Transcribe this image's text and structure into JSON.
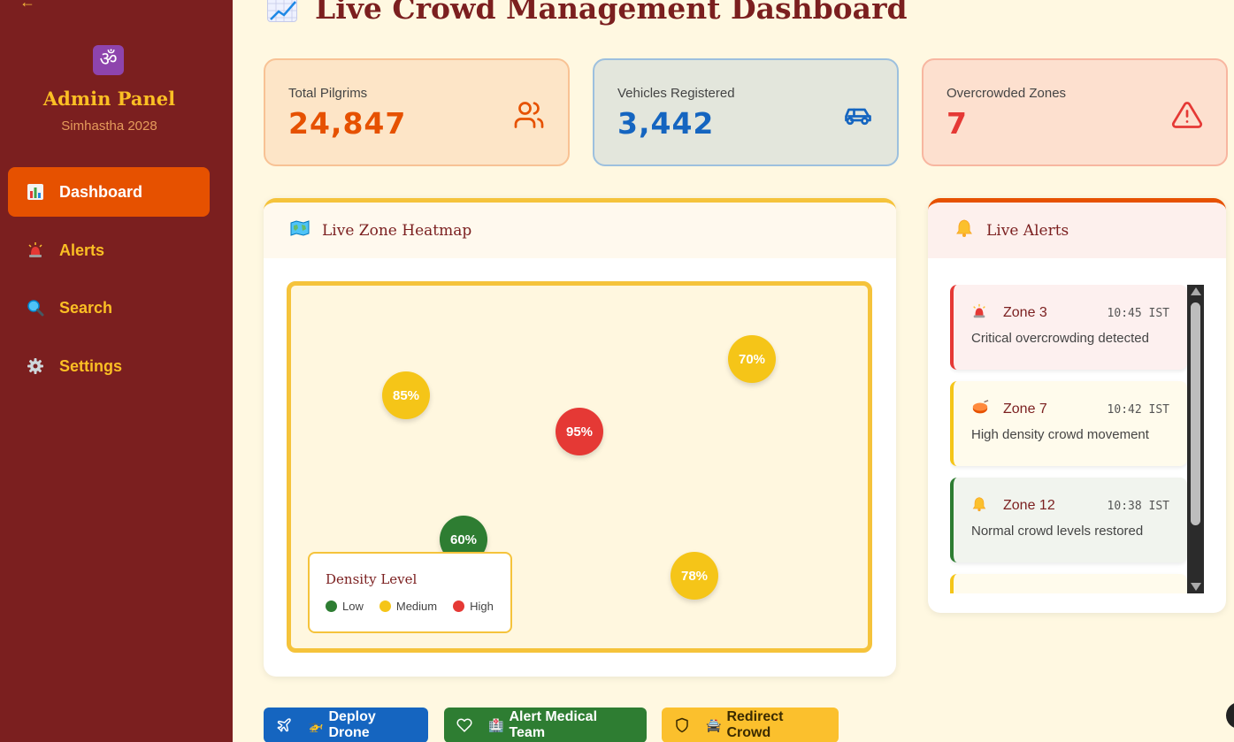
{
  "sidebar": {
    "om_symbol": "ॐ",
    "title": "Admin Panel",
    "subtitle": "Simhastha 2028",
    "items": [
      {
        "label": "Dashboard",
        "icon": "bar-chart-icon",
        "active": true
      },
      {
        "label": "Alerts",
        "icon": "siren-icon",
        "active": false
      },
      {
        "label": "Search",
        "icon": "magnifier-icon",
        "active": false
      },
      {
        "label": "Settings",
        "icon": "gear-icon",
        "active": false
      }
    ]
  },
  "header": {
    "title": "Live Crowd Management Dashboard"
  },
  "stats": [
    {
      "label": "Total Pilgrims",
      "value": "24,847",
      "icon": "users-icon",
      "color": "#e65100"
    },
    {
      "label": "Vehicles Registered",
      "value": "3,442",
      "icon": "car-icon",
      "color": "#1565c0"
    },
    {
      "label": "Overcrowded Zones",
      "value": "7",
      "icon": "warning-icon",
      "color": "#e53935"
    }
  ],
  "heatmap": {
    "title": "Live Zone Heatmap",
    "zones": [
      {
        "label": "85%",
        "level": "medium"
      },
      {
        "label": "70%",
        "level": "medium"
      },
      {
        "label": "95%",
        "level": "high"
      },
      {
        "label": "60%",
        "level": "low"
      },
      {
        "label": "78%",
        "level": "medium"
      }
    ],
    "legend": {
      "title": "Density Level",
      "low": "Low",
      "medium": "Medium",
      "high": "High"
    },
    "colors": {
      "low": "#2e7d32",
      "medium": "#f5c518",
      "high": "#e53935"
    }
  },
  "alerts": {
    "title": "Live Alerts",
    "items": [
      {
        "zone": "Zone 3",
        "time": "10:45 IST",
        "message": "Critical overcrowding detected",
        "severity": "critical",
        "icon": "siren-icon"
      },
      {
        "zone": "Zone 7",
        "time": "10:42 IST",
        "message": "High density crowd movement",
        "severity": "high",
        "icon": "drum-icon"
      },
      {
        "zone": "Zone 12",
        "time": "10:38 IST",
        "message": "Normal crowd levels restored",
        "severity": "normal",
        "icon": "bell-icon"
      }
    ]
  },
  "actions": [
    {
      "label": "Deploy Drone",
      "emoji": "🚁"
    },
    {
      "label": "Alert Medical Team",
      "emoji": "🏥"
    },
    {
      "label": "Redirect Crowd",
      "emoji": "🚔"
    }
  ]
}
